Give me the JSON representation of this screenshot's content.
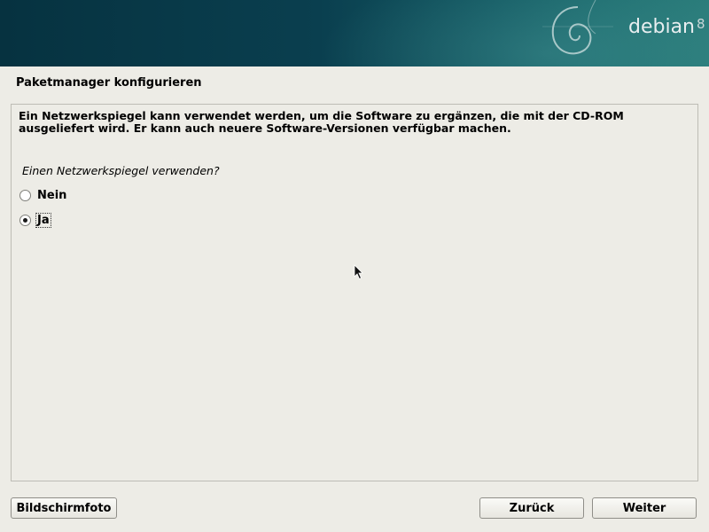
{
  "banner": {
    "brand": "debian",
    "version": "8"
  },
  "page": {
    "title": "Paketmanager konfigurieren"
  },
  "content": {
    "description": "Ein Netzwerkspiegel kann verwendet werden, um die Software zu ergänzen, die mit der CD-ROM ausgeliefert wird. Er kann auch neuere Software-Versionen verfügbar machen.",
    "question": "Einen Netzwerkspiegel verwenden?",
    "options": [
      {
        "label": "Nein",
        "selected": false
      },
      {
        "label": "Ja",
        "selected": true
      }
    ]
  },
  "buttons": {
    "screenshot": "Bildschirmfoto",
    "back": "Zurück",
    "next": "Weiter"
  },
  "icons": {
    "swirl": "debian-swirl-icon",
    "cursor": "mouse-pointer-icon",
    "radio": "radio-button-icon"
  }
}
